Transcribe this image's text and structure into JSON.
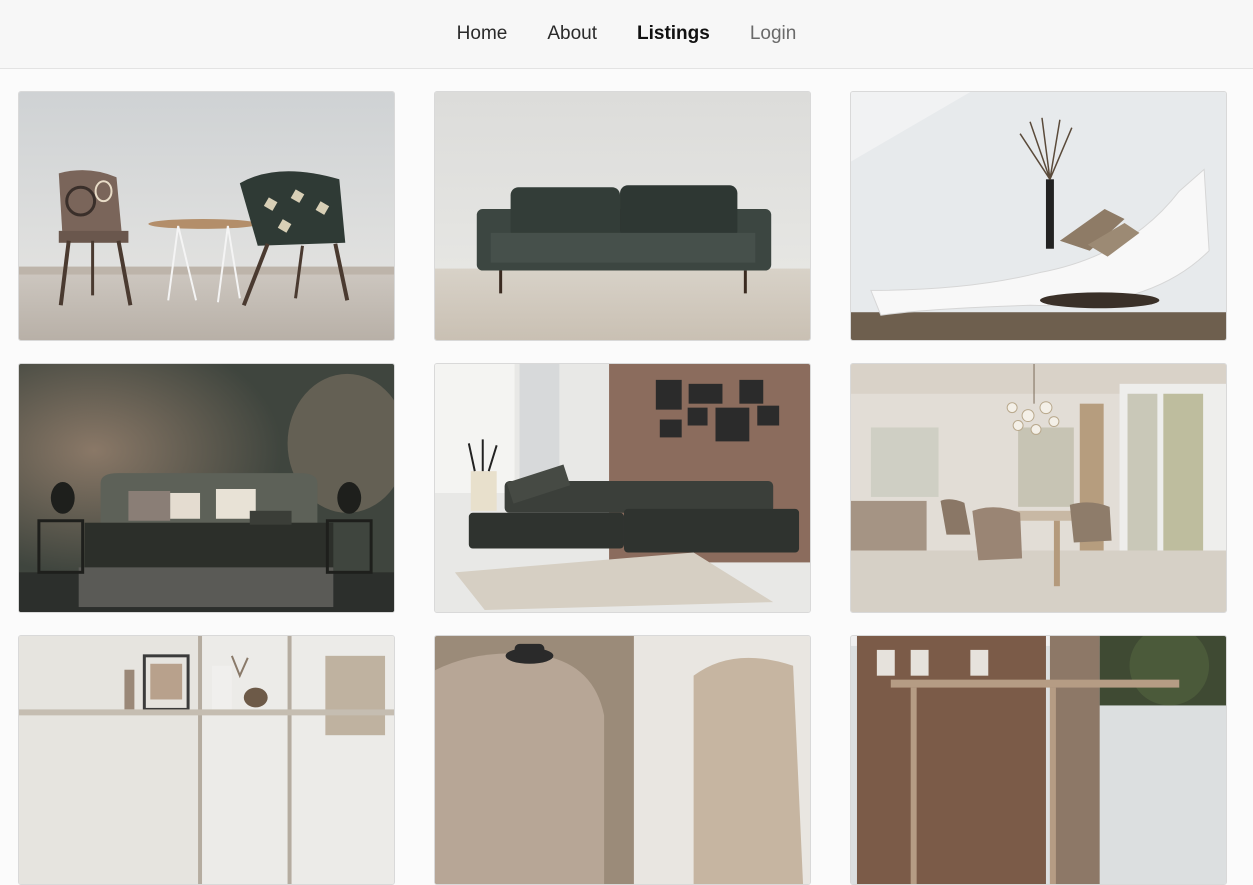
{
  "nav": {
    "items": [
      {
        "label": "Home"
      },
      {
        "label": "About"
      },
      {
        "label": "Listings"
      },
      {
        "label": "Login"
      }
    ],
    "active": "Listings"
  },
  "listings": [
    {
      "image": "two-patterned-chairs-with-side-table"
    },
    {
      "image": "dark-green-sofa"
    },
    {
      "image": "white-chaise-lounge"
    },
    {
      "image": "bedroom-with-dark-bed"
    },
    {
      "image": "living-room-sectional-sofa"
    },
    {
      "image": "dining-room-with-chandelier"
    },
    {
      "image": "living-room-with-shelves"
    },
    {
      "image": "armchairs-with-hat"
    },
    {
      "image": "brick-house-exterior"
    }
  ]
}
